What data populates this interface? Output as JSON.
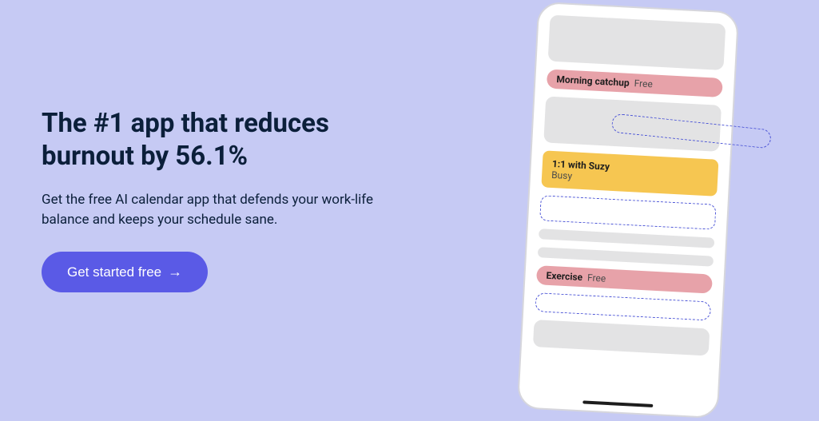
{
  "hero": {
    "headline": "The #1 app that reduces burnout by 56.1%",
    "subhead": "Get the free AI calendar app that defends your work-life balance and keeps your schedule sane.",
    "cta_label": "Get started free",
    "cta_arrow": "→"
  },
  "mock": {
    "events": [
      {
        "title": "Morning catchup",
        "status": "Free"
      },
      {
        "title": "1:1 with Suzy",
        "status": "Busy"
      },
      {
        "title": "Exercise",
        "status": "Free"
      }
    ]
  },
  "colors": {
    "bg": "#c6caf4",
    "accent": "#5a5ae6",
    "pink": "#e7a2a9",
    "yellow": "#f6c651",
    "dashed": "#4a53d6"
  }
}
